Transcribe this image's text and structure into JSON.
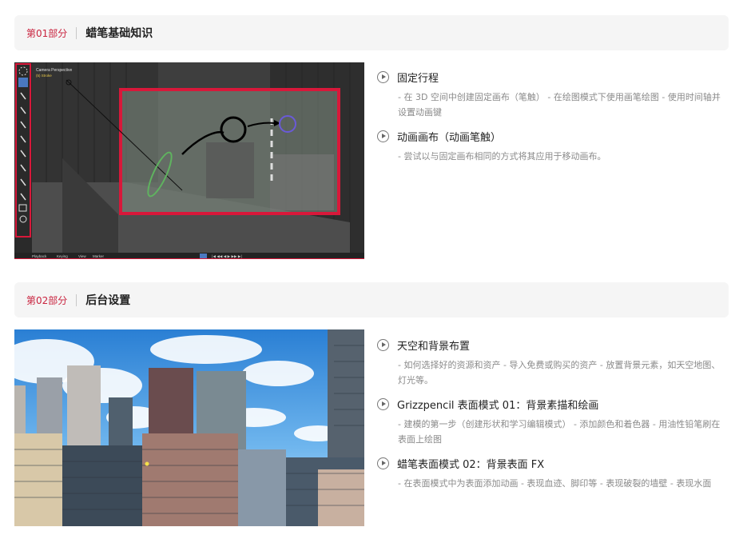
{
  "sections": [
    {
      "num": "第01部分",
      "title": "蜡笔基础知识",
      "editor": {
        "viewport_label": "Camera Perspective",
        "viewport_sublabel": "(5) Stroke",
        "timeline_items": [
          "Playback",
          "Keying",
          "View",
          "Marker"
        ]
      },
      "items": [
        {
          "title": "固定行程",
          "desc": "- 在 3D 空间中创建固定画布（笔触） - 在绘图模式下使用画笔绘图 - 使用时间轴并设置动画键"
        },
        {
          "title": "动画画布（动画笔触）",
          "desc": "- 尝试以与固定画布相同的方式将其应用于移动画布。"
        }
      ]
    },
    {
      "num": "第02部分",
      "title": "后台设置",
      "items": [
        {
          "title": "天空和背景布置",
          "desc": "- 如何选择好的资源和资产 - 导入免费或购买的资产 - 放置背景元素，如天空地图、灯光等。"
        },
        {
          "title": "Grizzpencil 表面模式 01：背景素描和绘画",
          "desc": "- 建模的第一步（创建形状和学习编辑模式） - 添加颜色和着色器 - 用油性铅笔刷在表面上绘图"
        },
        {
          "title": "蜡笔表面模式 02：背景表面 FX",
          "desc": "- 在表面模式中为表面添加动画 - 表现血迹、脚印等 - 表现破裂的墙壁 - 表现水面"
        }
      ]
    }
  ],
  "colors": {
    "accent": "#c9243f",
    "header_bg": "#f5f5f5",
    "desc": "#8a8a8a"
  }
}
